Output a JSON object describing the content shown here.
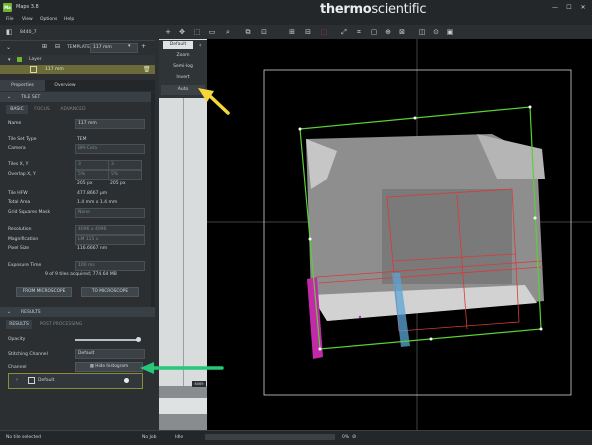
{
  "app": {
    "title": "Maps 3.8",
    "icon": "Ma",
    "brand_bold": "thermo",
    "brand_light": "scientific"
  },
  "window_controls": {
    "minimize": "—",
    "maximize": "☐",
    "close": "✕"
  },
  "menu": [
    "File",
    "View",
    "Options",
    "Help"
  ],
  "project": {
    "name": "8440_7"
  },
  "template": {
    "label": "TEMPLATE",
    "value": "117 mm"
  },
  "layers": {
    "group": "Layer",
    "item": "117 mm"
  },
  "panel_tabs": [
    "Properties",
    "Overview"
  ],
  "tile_set": {
    "header": "TILE SET",
    "tabs": [
      "BASIC",
      "FOCUS",
      "ADVANCED"
    ],
    "name_label": "Name",
    "name_value": "117 mm",
    "type_label": "Tile Set Type",
    "type_value": "TEM",
    "camera_label": "Camera",
    "camera_value": "BM-Ceta",
    "tiles_label": "Tiles X, Y",
    "tiles_x": "3",
    "tiles_y": "3",
    "overlap_label": "Overlap X, Y",
    "overlap_x": "5%",
    "overlap_y": "5%",
    "overlap_px_x": "205 px",
    "overlap_px_y": "205 px",
    "hfw_label": "Tile HFW",
    "hfw_value": "477.8667 µm",
    "area_label": "Total Area",
    "area_value": "1.4 mm x 1.4 mm",
    "grid_label": "Grid Squares Mask",
    "grid_value": "None",
    "res_label": "Resolution",
    "res_value": "4096 x 4096",
    "mag_label": "Magnification",
    "mag_value": "LM 115 x",
    "pix_label": "Pixel Size",
    "pix_value": "116.6667 nm",
    "exp_label": "Exposure Time",
    "exp_value": "100 ms",
    "summary": "9 of 9 tiles acquired; 774.64 MB",
    "from_btn": "FROM MICROSCOPE",
    "to_btn": "TO MICROSCOPE"
  },
  "results": {
    "header": "RESULTS",
    "tabs": [
      "RESULTS",
      "POST PROCESSING"
    ],
    "opacity_label": "Opacity",
    "opacity_level": 1.0,
    "stitch_label": "Stitching Channel",
    "stitch_value": "Default",
    "channel_label": "Channel",
    "hide_btn": "Hide histogram",
    "channel_name": "Default"
  },
  "display_dropdown": {
    "selected": "Default",
    "options": [
      "Zoom",
      "Semi-log",
      "Invert",
      "Auto"
    ]
  },
  "histogram": {
    "value": "6069"
  },
  "status": {
    "left": "No tile selected",
    "job": "No Job",
    "state": "Idle",
    "zoom": "0%"
  },
  "colors": {
    "accent_green": "#6fb534",
    "arrow_yellow": "#f5d73a",
    "arrow_green": "#27c77a",
    "tile_border": "#59d133",
    "tile_red": "#d83a3a",
    "magenta": "#c22aa8",
    "blue_strip": "#5aa6d6"
  }
}
